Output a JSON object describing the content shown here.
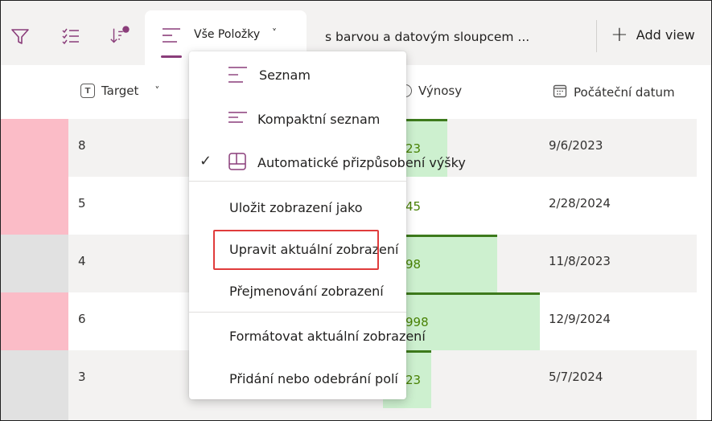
{
  "toolbar": {
    "icons": [
      "filter-icon",
      "checklist-icon",
      "sort-icon"
    ],
    "active_view": {
      "label": "Vše Položky",
      "chevron": "˅"
    },
    "second_view": "s barvou a datovým sloupcem ...",
    "add_view": {
      "label": "Add view",
      "plus": "+"
    },
    "indicator_color": "#8a3d7a"
  },
  "columns": [
    {
      "label": "Target",
      "icon": "T",
      "chevron": "˅"
    },
    {
      "label": "Výnosy",
      "icon": ""
    },
    {
      "label": "Počáteční datum",
      "icon": ""
    }
  ],
  "rows": [
    {
      "target": "8",
      "swatch": "#fbbcc7",
      "revenue_label": "23",
      "revenue_fraction": 0.41,
      "date": "9/6/2023"
    },
    {
      "target": "5",
      "swatch": "#fbbcc7",
      "revenue_label": "45",
      "revenue_fraction": 0.0,
      "date": "2/28/2024"
    },
    {
      "target": "4",
      "swatch": "#e1e1e1",
      "revenue_label": "98",
      "revenue_fraction": 0.73,
      "date": "11/8/2023"
    },
    {
      "target": "6",
      "swatch": "#fbbcc7",
      "revenue_label": "998",
      "revenue_fraction": 1.0,
      "date": "12/9/2024"
    },
    {
      "target": "3",
      "swatch": "#e1e1e1",
      "revenue_label": "23",
      "revenue_fraction": 0.31,
      "date": "5/7/2024"
    }
  ],
  "menu": {
    "layouts": [
      {
        "label": "Seznam",
        "icon": "list-icon",
        "checked": false
      },
      {
        "label": "Kompaktní seznam",
        "icon": "compact-list-icon",
        "checked": false
      },
      {
        "label": "Automatické přizpůsobení výšky",
        "icon": "autofit-icon",
        "checked": true,
        "check": "✓"
      }
    ],
    "actions": [
      {
        "label": "Uložit zobrazení jako"
      },
      {
        "label": "Upravit aktuální zobrazení",
        "highlighted": true
      },
      {
        "label": "Přejmenování zobrazení"
      }
    ],
    "more": [
      {
        "label": "Formátovat aktuální zobrazení"
      },
      {
        "label": "Přidání nebo odebrání polí"
      }
    ]
  },
  "colors": {
    "accent": "#8a3d7a",
    "bar_fill": "#cdf0cf",
    "bar_top": "#3d7a1c",
    "bar_text": "#498205",
    "highlight_box": "#e03c3c"
  }
}
